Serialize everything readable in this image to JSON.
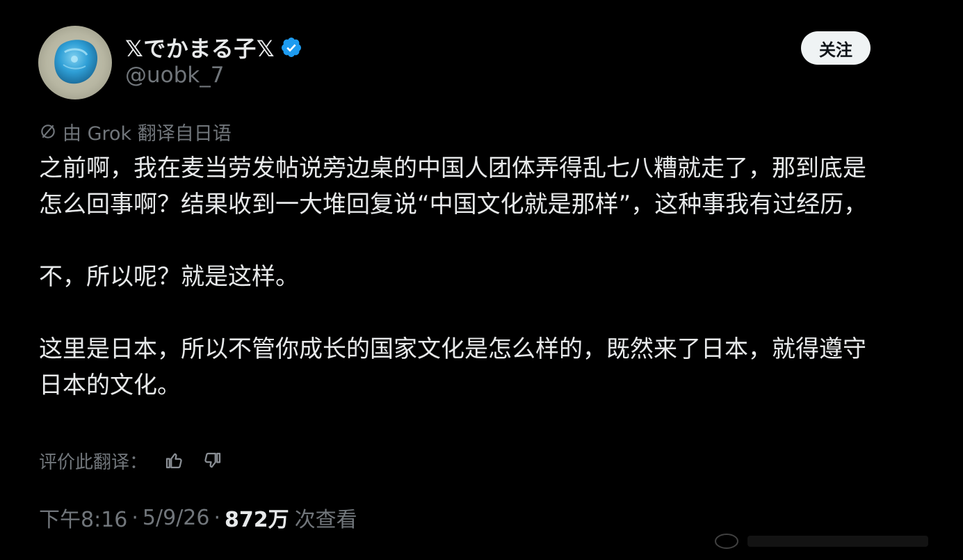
{
  "author": {
    "display_name": "𝕏でかまる子𝕏",
    "handle": "@uobk_7",
    "verified": true,
    "avatar_icon": "blue-stone-avatar"
  },
  "follow_button": {
    "label": "关注"
  },
  "translation_note": {
    "icon": "grok-icon",
    "text": "由 Grok 翻译自日语"
  },
  "post": {
    "paragraphs": [
      "之前啊，我在麦当劳发帖说旁边桌的中国人团体弄得乱七八糟就走了，那到底是怎么回事啊？结果收到一大堆回复说“中国文化就是那样”，这种事我有过经历，",
      "不，所以呢？就是这样。",
      "这里是日本，所以不管你成长的国家文化是怎么样的，既然来了日本，就得遵守日本的文化。"
    ]
  },
  "rating": {
    "label": "评价此翻译：",
    "thumbs_up_icon": "thumbs-up-icon",
    "thumbs_down_icon": "thumbs-down-icon"
  },
  "meta": {
    "time": "下午8:16",
    "separator": "·",
    "date": "5/9/26",
    "views_count": "872万",
    "views_label": "次查看"
  },
  "colors": {
    "background": "#000000",
    "text_primary": "#e7e9ea",
    "text_secondary": "#71767b",
    "verified_blue": "#1d9bf0",
    "follow_button_bg": "#eff3f4"
  }
}
